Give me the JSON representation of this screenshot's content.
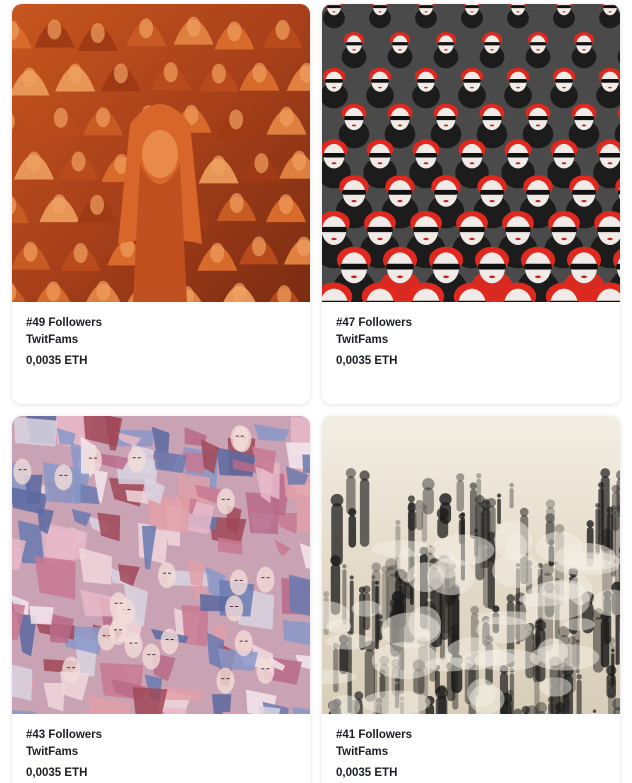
{
  "cards": [
    {
      "title": "#49 Followers",
      "creator": "TwitFams",
      "price": "0,0035 ETH",
      "artwork": "orange-hooded-crowd-painting"
    },
    {
      "title": "#47 Followers",
      "creator": "TwitFams",
      "price": "0,0035 ETH",
      "artwork": "red-hair-sunglasses-crowd-painting"
    },
    {
      "title": "#43 Followers",
      "creator": "TwitFams",
      "price": "0,0035 ETH",
      "artwork": "cubist-faces-crowd-painting"
    },
    {
      "title": "#41 Followers",
      "creator": "TwitFams",
      "price": "0,0035 ETH",
      "artwork": "ink-wash-crowd-painting"
    }
  ],
  "colors": {
    "text": "#1a1d24",
    "card_bg": "#ffffff",
    "art1_base": "#b8481c",
    "art2_base": "#3a3a3a",
    "art2_accent": "#e0281e",
    "art3_base": "#c896a8",
    "art4_base": "#ede6d8"
  }
}
